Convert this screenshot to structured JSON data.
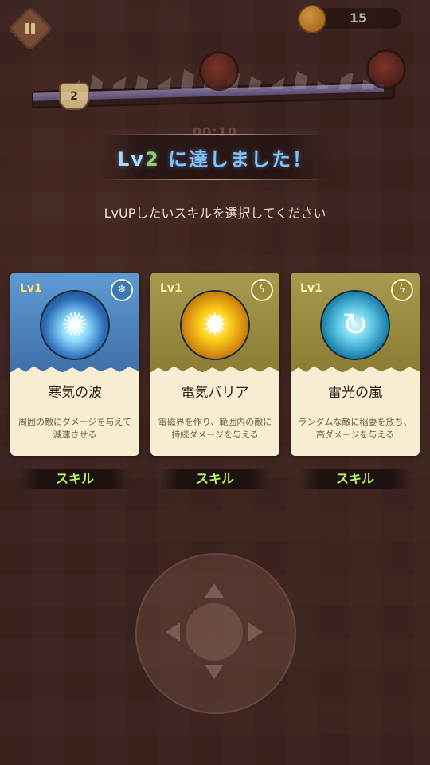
{
  "hud": {
    "coin_count": "15",
    "player_level": "2",
    "timer": "00:10",
    "pause_icon": "pause-icon",
    "coin_icon": "coin-icon"
  },
  "modal": {
    "title_prefix": "Lv",
    "title_level": "2",
    "title_suffix": " に達しました！",
    "subtitle": "LvUPしたいスキルを選択してください"
  },
  "cards": [
    {
      "level": "Lv1",
      "name": "寒気の波",
      "description": "周囲の敵にダメージを与えて減速させる",
      "tag": "スキル",
      "icon": "ice-crystal-icon",
      "badge_icon": "frost-swirl-icon",
      "theme": "blue"
    },
    {
      "level": "Lv1",
      "name": "電気バリア",
      "description": "電磁界を作り、範囲内の敵に持続ダメージを与える",
      "tag": "スキル",
      "icon": "electric-shield-icon",
      "badge_icon": "lightning-swirl-icon",
      "theme": "gold"
    },
    {
      "level": "Lv1",
      "name": "雷光の嵐",
      "description": "ランダムな敵に稲妻を放ち、高ダメージを与える",
      "tag": "スキル",
      "icon": "lightning-storm-icon",
      "badge_icon": "lightning-swirl-icon",
      "theme": "gold"
    }
  ],
  "colors": {
    "title": "#7fc3ff",
    "level_number": "#8fd26a",
    "skill_tag": "#b6f06a",
    "card_level": "#ffe06a"
  }
}
